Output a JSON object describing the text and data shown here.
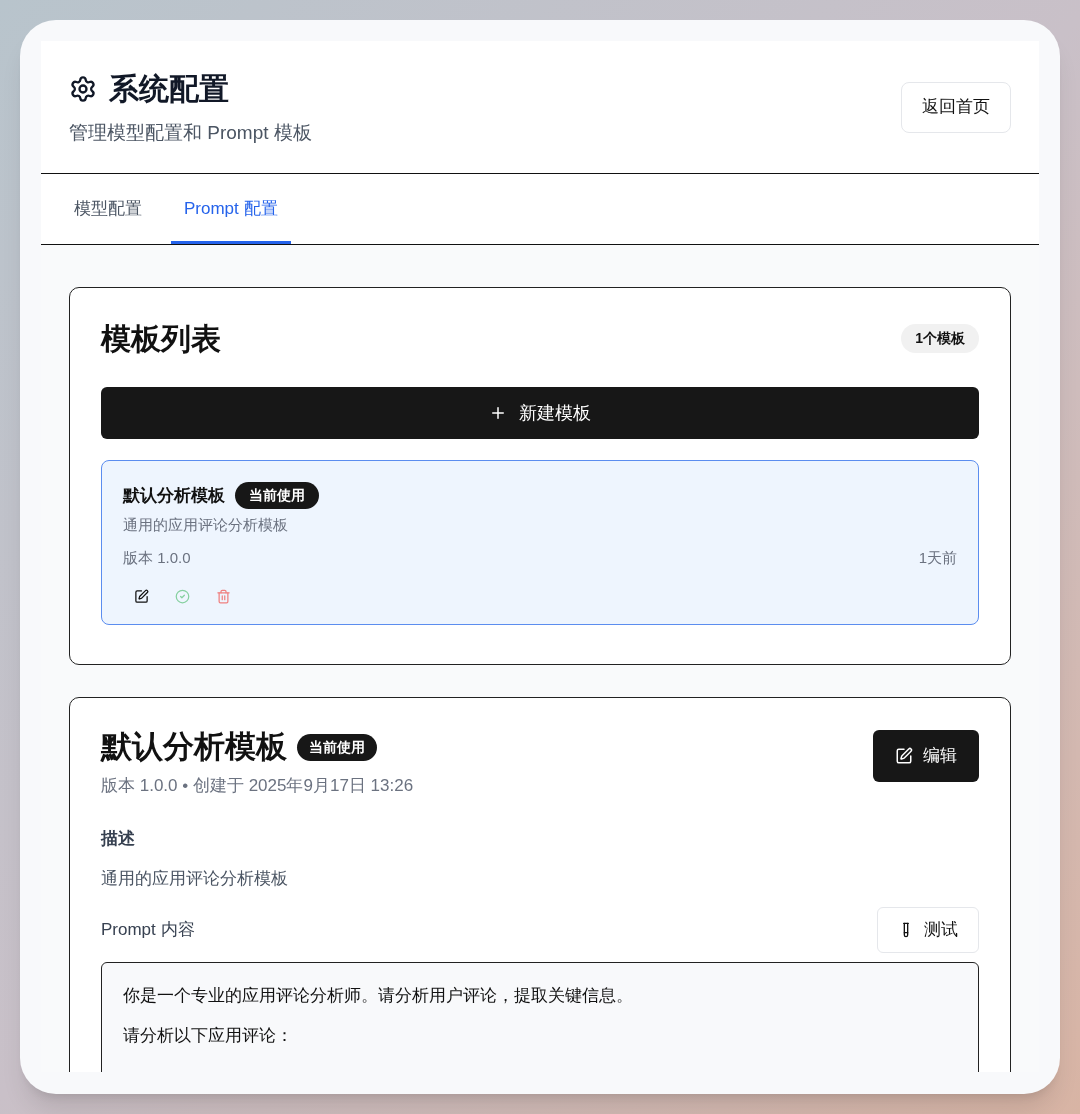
{
  "header": {
    "title": "系统配置",
    "subtitle": "管理模型配置和 Prompt 模板",
    "back_button": "返回首页"
  },
  "tabs": [
    {
      "label": "模型配置",
      "selected": false
    },
    {
      "label": "Prompt 配置",
      "selected": true
    }
  ],
  "template_list": {
    "title": "模板列表",
    "count": "1个模板",
    "new_button": "新建模板",
    "items": [
      {
        "name": "默认分析模板",
        "badge": "当前使用",
        "description": "通用的应用评论分析模板",
        "version": "版本 1.0.0",
        "time": "1天前",
        "selected": true
      }
    ]
  },
  "detail": {
    "title": "默认分析模板",
    "badge": "当前使用",
    "meta": "版本 1.0.0 • 创建于 2025年9月17日 13:26",
    "edit_button": "编辑",
    "description_label": "描述",
    "description": "通用的应用评论分析模板",
    "prompt_label": "Prompt 内容",
    "test_button": "测试",
    "prompt_lines": [
      "你是一个专业的应用评论分析师。请分析用户评论，提取关键信息。",
      "请分析以下应用评论："
    ]
  }
}
